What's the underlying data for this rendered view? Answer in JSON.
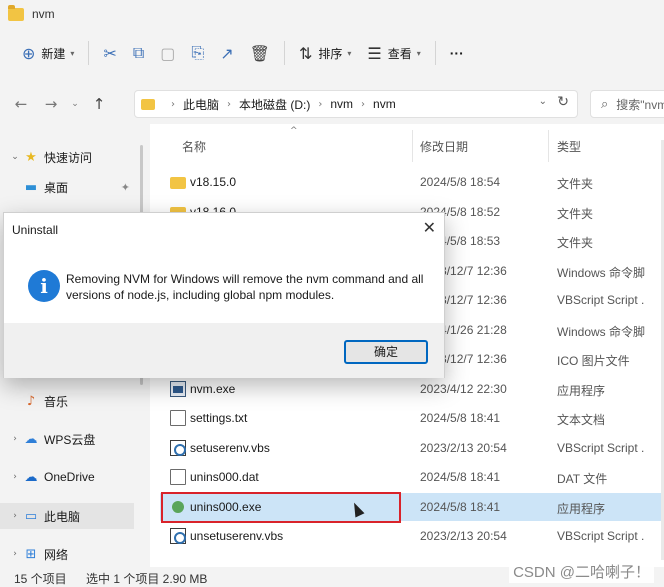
{
  "window": {
    "title": "nvm"
  },
  "toolbar": {
    "new_label": "新建",
    "sort_label": "排序",
    "view_label": "查看",
    "more_label": "···"
  },
  "address": {
    "crumbs": [
      "此电脑",
      "本地磁盘 (D:)",
      "nvm",
      "nvm"
    ],
    "search_placeholder": "搜索\"nvm\""
  },
  "sidebar": {
    "items": [
      {
        "label": "快速访问",
        "icon": "star-icon",
        "expand": "⌄"
      },
      {
        "label": "桌面",
        "icon": "desktop-icon"
      },
      {
        "label": "音乐",
        "icon": "music-icon"
      },
      {
        "label": "WPS云盘",
        "icon": "cloud-icon",
        "expand": "›"
      },
      {
        "label": "OneDrive",
        "icon": "onedrive-icon",
        "expand": "›"
      },
      {
        "label": "此电脑",
        "icon": "computer-icon",
        "expand": "›"
      },
      {
        "label": "网络",
        "icon": "network-icon",
        "expand": "›"
      }
    ]
  },
  "columns": {
    "name": "名称",
    "date": "修改日期",
    "type": "类型"
  },
  "files": [
    {
      "name": "v18.15.0",
      "date": "2024/5/8 18:54",
      "type": "文件夹",
      "icon": "folder-icon"
    },
    {
      "name": "v18.16.0",
      "date": "2024/5/8 18:52",
      "type": "文件夹",
      "icon": "folder-icon"
    },
    {
      "name": "",
      "date": "2024/5/8 18:53",
      "type": "文件夹",
      "icon": "folder-icon"
    },
    {
      "name": "",
      "date": "2023/12/7 12:36",
      "type": "Windows 命令脚",
      "icon": "cmd-icon"
    },
    {
      "name": "",
      "date": "2023/12/7 12:36",
      "type": "VBScript Script .",
      "icon": "vbs-icon"
    },
    {
      "name": "",
      "date": "2024/1/26 21:28",
      "type": "Windows 命令脚",
      "icon": "cmd-icon"
    },
    {
      "name": "",
      "date": "2023/12/7 12:36",
      "type": "ICO 图片文件",
      "icon": "ico-icon"
    },
    {
      "name": "nvm.exe",
      "date": "2023/4/12 22:30",
      "type": "应用程序",
      "icon": "exe-icon"
    },
    {
      "name": "settings.txt",
      "date": "2024/5/8 18:41",
      "type": "文本文档",
      "icon": "text-file-icon"
    },
    {
      "name": "setuserenv.vbs",
      "date": "2023/2/13 20:54",
      "type": "VBScript Script .",
      "icon": "vbs-icon"
    },
    {
      "name": "unins000.dat",
      "date": "2024/5/8 18:41",
      "type": "DAT 文件",
      "icon": "dat-file-icon"
    },
    {
      "name": "unins000.exe",
      "date": "2024/5/8 18:41",
      "type": "应用程序",
      "icon": "installer-icon",
      "selected": true
    },
    {
      "name": "unsetuserenv.vbs",
      "date": "2023/2/13 20:54",
      "type": "VBScript Script .",
      "icon": "vbs-icon"
    }
  ],
  "status": {
    "count": "15 个项目",
    "selection": "选中 1 个项目  2.90 MB"
  },
  "dialog": {
    "title": "Uninstall",
    "message": "Removing NVM for Windows will remove the nvm command and all versions of node.js, including global npm modules.",
    "ok_label": "确定"
  },
  "watermark": "CSDN @二哈喇子！"
}
